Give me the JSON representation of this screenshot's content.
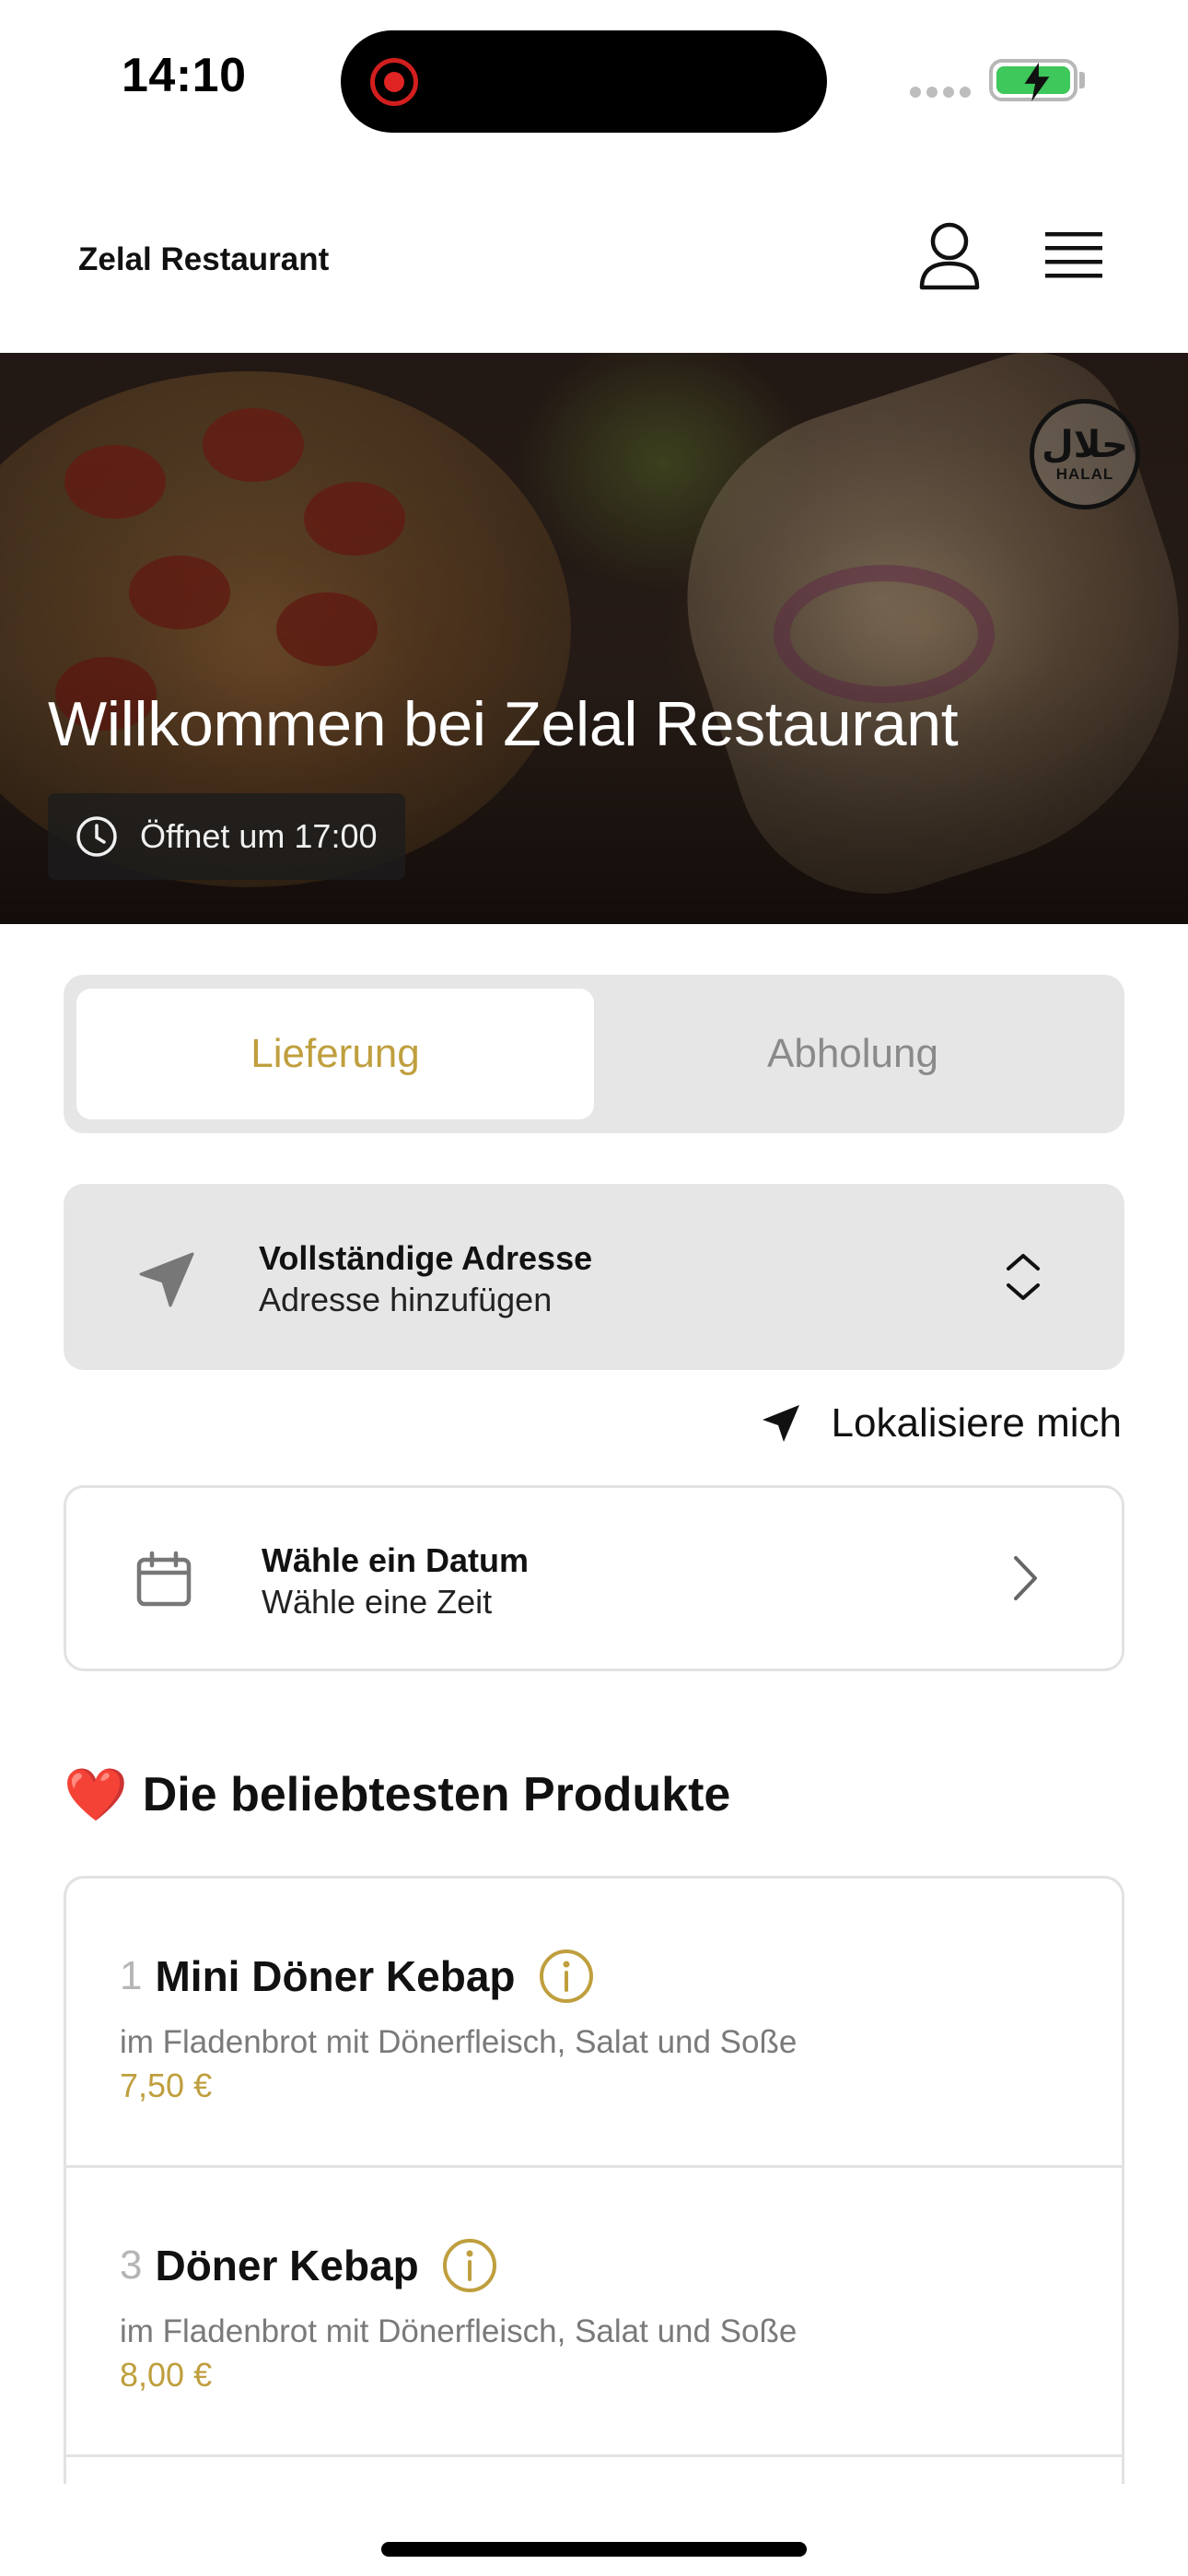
{
  "status_bar": {
    "time": "14:10",
    "battery_color": "#3ec75a",
    "recording_color": "#e02424"
  },
  "header": {
    "brand": "Zelal Restaurant",
    "user_icon": "user-icon",
    "menu_icon": "hamburger-menu-icon"
  },
  "hero": {
    "title": "Willkommen bei Zelal Restaurant",
    "badge_arabic": "حلال",
    "badge_label": "HALAL",
    "hours": "Öffnet um 17:00"
  },
  "order_mode": {
    "options": [
      "Lieferung",
      "Abholung"
    ],
    "selected": "Lieferung"
  },
  "address": {
    "title": "Vollständige Adresse",
    "subtitle": "Adresse hinzufügen",
    "icon": "location-arrow-icon"
  },
  "locate": {
    "label": "Lokalisiere mich"
  },
  "date": {
    "title": "Wähle ein Datum",
    "subtitle": "Wähle eine Zeit",
    "icon": "calendar-icon"
  },
  "popular": {
    "emoji": "❤️",
    "title": "Die beliebtesten Produkte",
    "items": [
      {
        "number": "1",
        "name": "Mini Döner Kebap",
        "description": "im Fladenbrot mit Dönerfleisch, Salat und Soße",
        "price": "7,50 €"
      },
      {
        "number": "3",
        "name": "Döner Kebap",
        "description": "im Fladenbrot mit Dönerfleisch, Salat und Soße",
        "price": "8,00 €"
      }
    ]
  },
  "accent_color": "#bf9f3e"
}
